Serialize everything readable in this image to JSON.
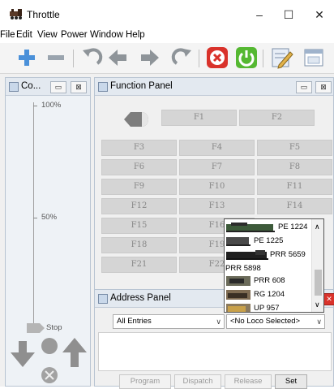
{
  "window": {
    "title": "Throttle",
    "minimize": "–",
    "maximize": "☐",
    "close": "✕"
  },
  "menu": [
    "File",
    "Edit",
    "View",
    "Power",
    "Window",
    "Help"
  ],
  "toolbar": {
    "icons": [
      "add-icon",
      "remove-icon",
      "undo-icon",
      "arrow-left-icon",
      "arrow-right-icon",
      "redo-icon",
      "stop-icon",
      "power-icon",
      "edit-icon",
      "window-icon"
    ]
  },
  "control_panel": {
    "title": "Co...",
    "speed_labels": {
      "top": "100%",
      "middle": "50%",
      "bottom": "Stop"
    },
    "speed_level_pct": 0
  },
  "function_panel": {
    "title": "Function Panel",
    "buttons": [
      "F1",
      "F2",
      "F3",
      "F4",
      "F5",
      "F6",
      "F7",
      "F8",
      "F9",
      "F10",
      "F11",
      "F12",
      "F13",
      "F14",
      "F15",
      "F16",
      "F18",
      "F19",
      "F21",
      "F22"
    ]
  },
  "address_panel": {
    "title": "Address Panel",
    "filter_value": "All Entries",
    "loco_value": "<No Loco Selected>",
    "buttons": {
      "program": "Program",
      "dispatch": "Dispatch",
      "release": "Release",
      "set": "Set"
    }
  },
  "roster": {
    "items": [
      "PE 1224",
      "PE 1225",
      "PRR 5659",
      "PRR 5898",
      "PRR 608",
      "RG 1204",
      "UP 957"
    ]
  },
  "colors": {
    "stop_red": "#d9322b",
    "power_green": "#55b832",
    "toolbar_blue": "#4a90d9"
  }
}
